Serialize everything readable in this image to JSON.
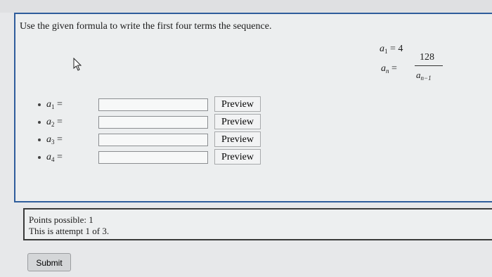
{
  "question": {
    "prompt": "Use the given formula to write the first four terms the sequence.",
    "formula": {
      "a1_var": "a",
      "a1_sub": "1",
      "a1_eq": "= 4",
      "numerator": "128",
      "lhs_var": "a",
      "lhs_sub": "n",
      "equals": "=",
      "denominator_var": "a",
      "denominator_sub": "n−1"
    },
    "rows": [
      {
        "var": "a",
        "sub": "1",
        "eq": " =",
        "input_value": "",
        "preview_label": "Preview"
      },
      {
        "var": "a",
        "sub": "2",
        "eq": " =",
        "input_value": "",
        "preview_label": "Preview"
      },
      {
        "var": "a",
        "sub": "3",
        "eq": " =",
        "input_value": "",
        "preview_label": "Preview"
      },
      {
        "var": "a",
        "sub": "4",
        "eq": " =",
        "input_value": "",
        "preview_label": "Preview"
      }
    ]
  },
  "status": {
    "points": "Points possible: 1",
    "attempt": "This is attempt 1 of 3."
  },
  "submit_label": "Submit",
  "colors": {
    "question_border": "#2f5d9c",
    "status_border": "#3a3a3a"
  }
}
